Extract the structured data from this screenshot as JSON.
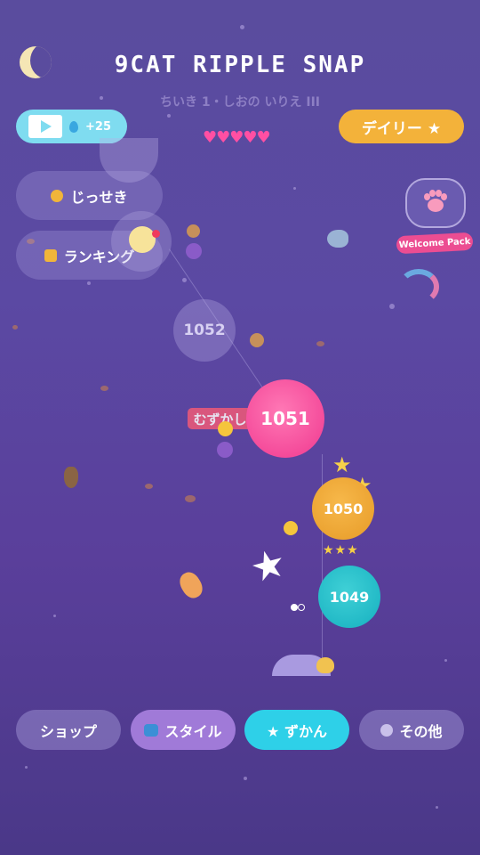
{
  "header": {
    "title": "9CAT RIPPLE SNAP",
    "subtitle": "ちいき 1・しおの いりえ III",
    "moon_icon": "moon-icon"
  },
  "video_reward": {
    "label": "+25",
    "icons": [
      "film-icon",
      "drop-icon"
    ]
  },
  "lives": {
    "hearts": "♥♥♥♥♥",
    "count": 5,
    "color": "#ff4fa3"
  },
  "daily_button": {
    "label": "デイリー ★",
    "color": "#f3b23a"
  },
  "side_buttons": {
    "record_label": "じっせき",
    "ranking_label": "ランキング"
  },
  "welcome_pack": {
    "label": "Welcome Pack",
    "icon": "paw-icon"
  },
  "board": {
    "balls": [
      {
        "number": "1052",
        "state": "faded"
      },
      {
        "number": "1051",
        "state": "current",
        "color": "#f0388f"
      },
      {
        "number": "1050",
        "state": "cleared",
        "color": "#e79b28"
      },
      {
        "number": "1049",
        "state": "cleared",
        "color": "#16b0c0"
      }
    ],
    "hard_label": "むずかしい",
    "rating_stars": "★★★"
  },
  "nav": {
    "shop": "ショップ",
    "style": "スタイル",
    "zukan": "★ ずかん",
    "other": "その他"
  }
}
